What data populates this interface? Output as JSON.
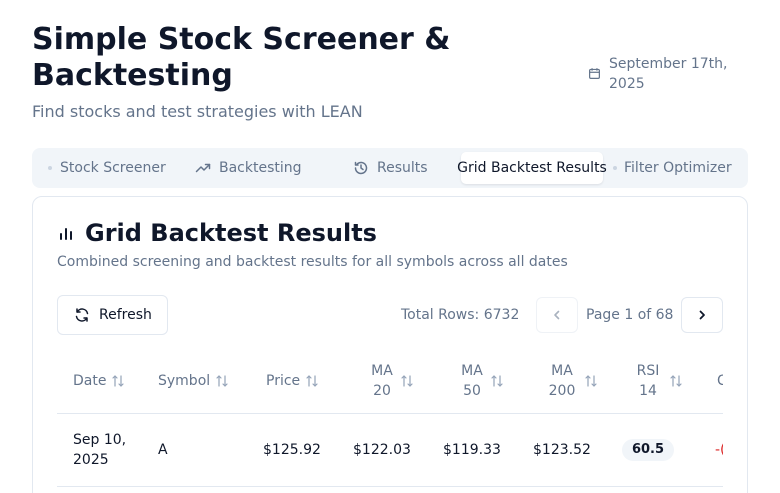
{
  "header": {
    "title": "Simple Stock Screener & Backtesting",
    "subtitle": "Find stocks and test strategies with LEAN",
    "date": "September 17th, 2025",
    "date_icon": "calendar-icon"
  },
  "tabs": [
    {
      "label": "Stock Screener",
      "icon": "dot-icon",
      "active": false
    },
    {
      "label": "Backtesting",
      "icon": "trending-up-icon",
      "active": false
    },
    {
      "label": "Results",
      "icon": "history-icon",
      "active": false
    },
    {
      "label": "Grid Backtest Results",
      "icon": "",
      "active": true
    },
    {
      "label": "Filter Optimizer",
      "icon": "dot-icon",
      "active": false
    }
  ],
  "card": {
    "title": "Grid Backtest Results",
    "title_icon": "bar-chart-icon",
    "description": "Combined screening and backtest results for all symbols across all dates",
    "refresh_label": "Refresh",
    "total_rows": "Total Rows: 6732",
    "page_label": "Page 1 of 68"
  },
  "table": {
    "columns": [
      "Date",
      "Symbol",
      "Price",
      "MA 20",
      "MA 50",
      "MA 200",
      "RSI 14",
      "C"
    ],
    "rows": [
      {
        "date": "Sep 10, 2025",
        "symbol": "A",
        "price": "$125.92",
        "ma20": "$122.03",
        "ma50": "$119.33",
        "ma200": "$123.52",
        "rsi14": "60.5",
        "next": "-("
      }
    ]
  },
  "colors": {
    "accent_text": "#0f172a",
    "muted_text": "#64748b",
    "tab_bg": "#f1f5f9",
    "border": "#e2e8f0",
    "negative": "#dc2626"
  }
}
